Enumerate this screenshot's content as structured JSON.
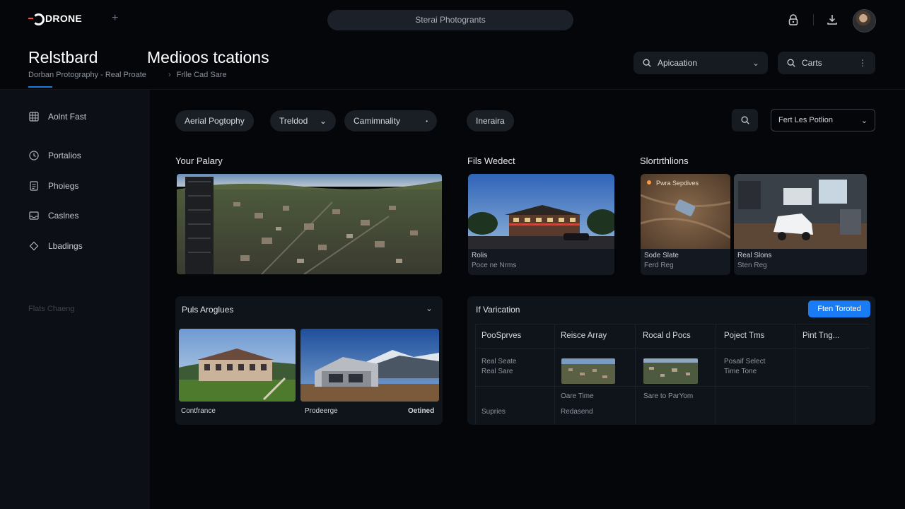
{
  "brand": "DRONE",
  "search": {
    "label": "Sterai Photogrants"
  },
  "header": {
    "title_left": "Relstbard",
    "title_main": "Medioos tcations",
    "breadcrumb_left": "Dorban Protography - Real Proate",
    "breadcrumb_right": "Frlle Cad Sare",
    "select_application": "Apicaation",
    "select_carts": "Carts"
  },
  "sidebar": {
    "items": [
      {
        "label": "Aolnt Fast",
        "icon": "grid-icon"
      },
      {
        "label": "Portalios",
        "icon": "clock-icon"
      },
      {
        "label": "Phoiegs",
        "icon": "document-icon"
      },
      {
        "label": "Caslnes",
        "icon": "inbox-icon"
      },
      {
        "label": "Lbadings",
        "icon": "diamond-icon"
      }
    ],
    "footer": "Flats Chaeng"
  },
  "filters": {
    "pill1": "Aerial Pogtophy",
    "pill2": "Treldod",
    "pill3": "Camimnality",
    "pill4": "Ineraira",
    "sort": "Fert Les Potlion"
  },
  "gallery": {
    "title": "Your Palary",
    "feature_title": "Fils Wedect",
    "feature_cap1": "Rolis",
    "feature_cap2": "Poce ne Nrms",
    "short_title": "Slortrthlions",
    "short1_tag": "Pwra Sepdives",
    "short1_cap1": "Sode Slate",
    "short1_cap2": "Ferd Reg",
    "short2_cap1": "Real Slons",
    "short2_cap2": "Sten Reg"
  },
  "public": {
    "title": "Puls Aroglues",
    "cap_left": "Contfrance",
    "cap_mid": "Prodeerge",
    "cap_right": "Oetined"
  },
  "verification": {
    "title": "If Varication",
    "button": "Ften Toroted",
    "headers": [
      "PooSprves",
      "Reisce Array",
      "Rocal d Pocs",
      "Poject Tms",
      "Pint Tng..."
    ],
    "cell_r1c1a": "Real Seate",
    "cell_r1c1b": "Real Sare",
    "cell_r1c4a": "Posaif Select",
    "cell_r1c4b": "Time Tone",
    "cell_r2c2": "Oare Time",
    "cell_r2c3": "Sare to ParYom",
    "cell_r3c1": "Supries",
    "cell_r3c2": "Redasend"
  }
}
